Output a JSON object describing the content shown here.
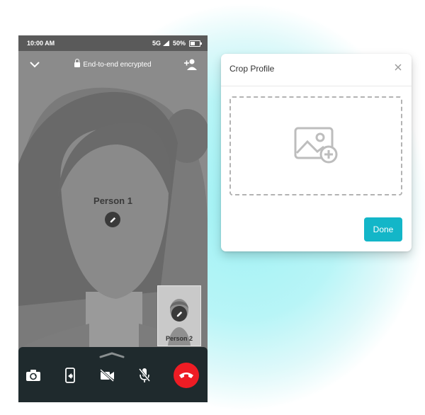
{
  "status_bar": {
    "time": "10:00 AM",
    "network": "5G",
    "battery": "50%"
  },
  "call_header": {
    "encryption_label": "End-to-end encrypted"
  },
  "main_video": {
    "participant_name": "Person 1"
  },
  "pip_video": {
    "participant_name": "Person 2"
  },
  "controls": {
    "icons": [
      "switch-camera-icon",
      "screen-share-icon",
      "video-off-icon",
      "mic-off-icon",
      "end-call-icon"
    ]
  },
  "dialog": {
    "title": "Crop Profile",
    "done_label": "Done"
  },
  "colors": {
    "accent": "#13b6c8",
    "end_call": "#ee1c24",
    "control_bar": "#1f2a2d",
    "glow": "#9ff1f4"
  }
}
